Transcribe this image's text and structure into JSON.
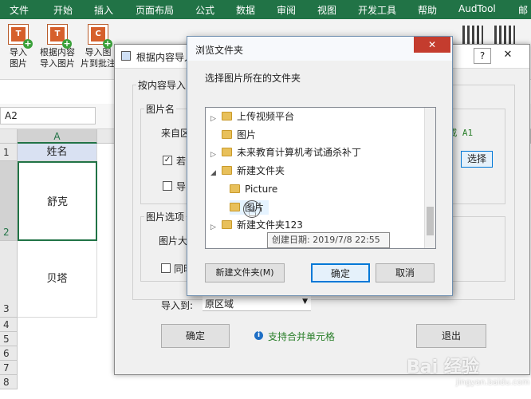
{
  "ribbon_tabs": [
    "文件",
    "开始",
    "插入",
    "页面布局",
    "公式",
    "数据",
    "审阅",
    "视图",
    "开发工具",
    "帮助",
    "AudTool",
    "邮"
  ],
  "ribbon_buttons": [
    {
      "label1": "导入",
      "label2": "图片",
      "icon_text": "T"
    },
    {
      "label1": "根据内容",
      "label2": "导入图片",
      "icon_text": "T"
    },
    {
      "label1": "导入图",
      "label2": "片到批注",
      "icon_text": "C"
    }
  ],
  "name_box": "A2",
  "sheet": {
    "col_a": "A",
    "rows": [
      "1",
      "2",
      "3",
      "4",
      "5",
      "6",
      "7",
      "8"
    ],
    "cells": {
      "a1": "姓名",
      "a2": "舒克",
      "a3": "贝塔"
    }
  },
  "bg_dialog": {
    "title": "根据内容导入图",
    "group_label": "按内容导入图",
    "pic_name_legend": "图片名",
    "source_label": "来自区",
    "checkbox1_label": "若",
    "checkbox2_label": "导",
    "right_hint": "g 或 A1",
    "select_button": "选择",
    "pic_options_legend": "图片选项",
    "pic_size_label": "图片大",
    "sync_label": "同时",
    "import_to_label": "导入到:",
    "import_to_value": "原区域",
    "ok_button": "确定",
    "merge_hint": "支持合并单元格",
    "exit_button": "退出"
  },
  "browse_dialog": {
    "title": "浏览文件夹",
    "prompt": "选择图片所在的文件夹",
    "folders": [
      "上传视频平台",
      "图片",
      "未来教育计算机考试通杀补丁",
      "新建文件夹",
      "Picture",
      "图片",
      "新建文件夹123"
    ],
    "tooltip": "创建日期: 2019/7/8 22:55",
    "new_folder_button": "新建文件夹(M)",
    "ok_button": "确定",
    "cancel_button": "取消",
    "close_glyph": "✕"
  },
  "watermark": {
    "main": "Bai 经验",
    "sub": "jingyan.baidu.com"
  },
  "colors": {
    "excel_green": "#217346",
    "accent_blue": "#0a5fb4"
  }
}
